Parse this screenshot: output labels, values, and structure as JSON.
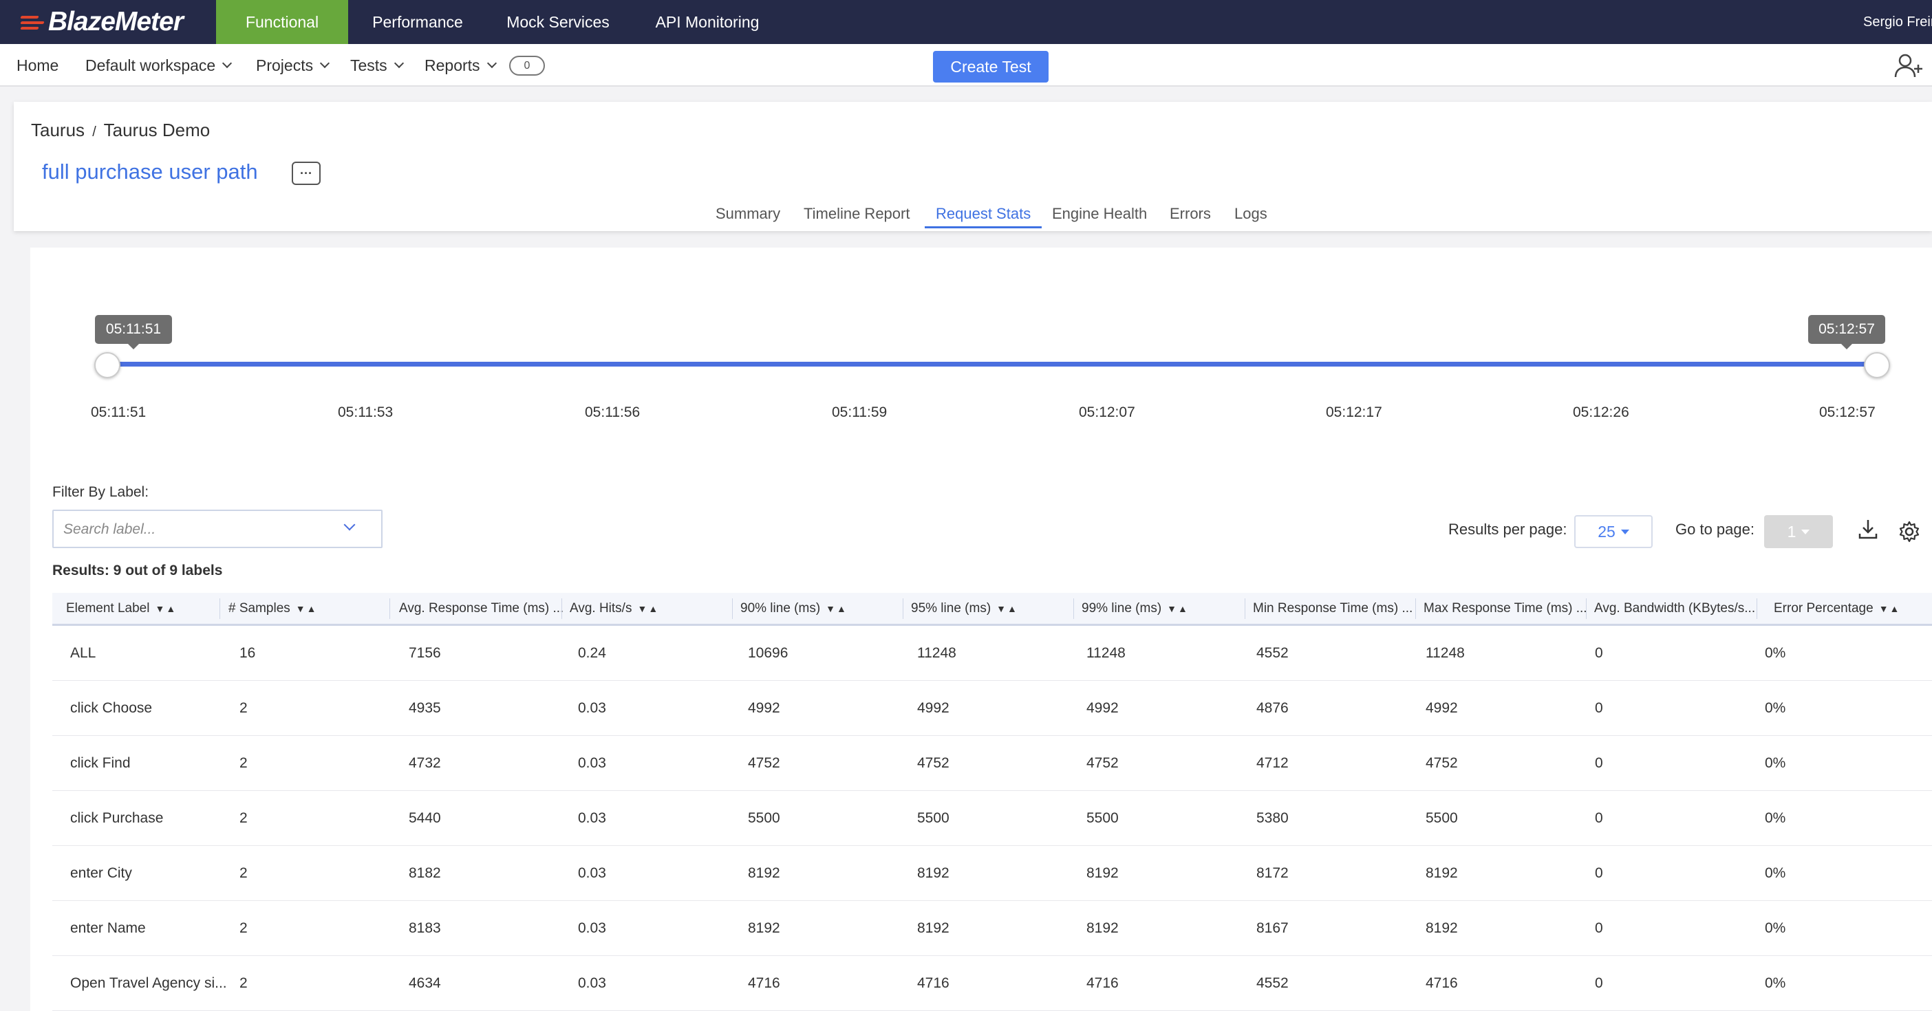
{
  "app": {
    "brand": "BlazeMeter",
    "brand_color": "#e2452b",
    "nav_tabs": [
      "Functional",
      "Performance",
      "Mock Services",
      "API Monitoring"
    ],
    "active_tab": "Functional",
    "user_name": "Sergio Freire"
  },
  "subnav": {
    "home": "Home",
    "workspace": "Default workspace",
    "projects": "Projects",
    "tests": "Tests",
    "reports": "Reports",
    "reports_count": "0",
    "create_test": "Create Test",
    "add_user_icon": "add-user-icon"
  },
  "header": {
    "breadcrumb_project": "Taurus",
    "breadcrumb_sep": "/",
    "breadcrumb_test": "Taurus Demo",
    "title": "full purchase user path",
    "more_label": "···",
    "tabs": [
      "Summary",
      "Timeline Report",
      "Request Stats",
      "Engine Health",
      "Errors",
      "Logs"
    ],
    "active_tab": "Request Stats"
  },
  "timeline": {
    "start_label": "05:11:51",
    "end_label": "05:12:57",
    "ticks": [
      "05:11:51",
      "05:11:53",
      "05:11:56",
      "05:11:59",
      "05:12:07",
      "05:12:17",
      "05:12:26",
      "05:12:57"
    ]
  },
  "filter": {
    "label": "Filter By Label:",
    "placeholder": "Search label..."
  },
  "pagination": {
    "results_per_page_label": "Results per page:",
    "results_per_page": "25",
    "go_to_page_label": "Go to page:",
    "page": "1"
  },
  "results_count": "Results: 9 out of 9 labels",
  "table": {
    "columns": [
      "Element Label",
      "# Samples",
      "Avg. Response Time (ms) ...",
      "Avg. Hits/s",
      "90% line (ms)",
      "95% line (ms)",
      "99% line (ms)",
      "Min Response Time (ms) ...",
      "Max Response Time (ms) ...",
      "Avg. Bandwidth (KBytes/s...",
      "Error Percentage"
    ],
    "sort_glyph": "▼▲",
    "rows": [
      [
        "ALL",
        "16",
        "7156",
        "0.24",
        "10696",
        "11248",
        "11248",
        "4552",
        "11248",
        "0",
        "0%"
      ],
      [
        "click Choose",
        "2",
        "4935",
        "0.03",
        "4992",
        "4992",
        "4992",
        "4876",
        "4992",
        "0",
        "0%"
      ],
      [
        "click Find",
        "2",
        "4732",
        "0.03",
        "4752",
        "4752",
        "4752",
        "4712",
        "4752",
        "0",
        "0%"
      ],
      [
        "click Purchase",
        "2",
        "5440",
        "0.03",
        "5500",
        "5500",
        "5500",
        "5380",
        "5500",
        "0",
        "0%"
      ],
      [
        "enter City",
        "2",
        "8182",
        "0.03",
        "8192",
        "8192",
        "8192",
        "8172",
        "8192",
        "0",
        "0%"
      ],
      [
        "enter Name",
        "2",
        "8183",
        "0.03",
        "8192",
        "8192",
        "8192",
        "8167",
        "8192",
        "0",
        "0%"
      ],
      [
        "Open Travel Agency si...",
        "2",
        "4634",
        "0.03",
        "4716",
        "4716",
        "4716",
        "4552",
        "4716",
        "0",
        "0%"
      ]
    ]
  },
  "colors": {
    "topbar": "#252a48",
    "active_green": "#68a83c",
    "accent_blue": "#3f72e2",
    "button_blue": "#4b7ef0"
  }
}
